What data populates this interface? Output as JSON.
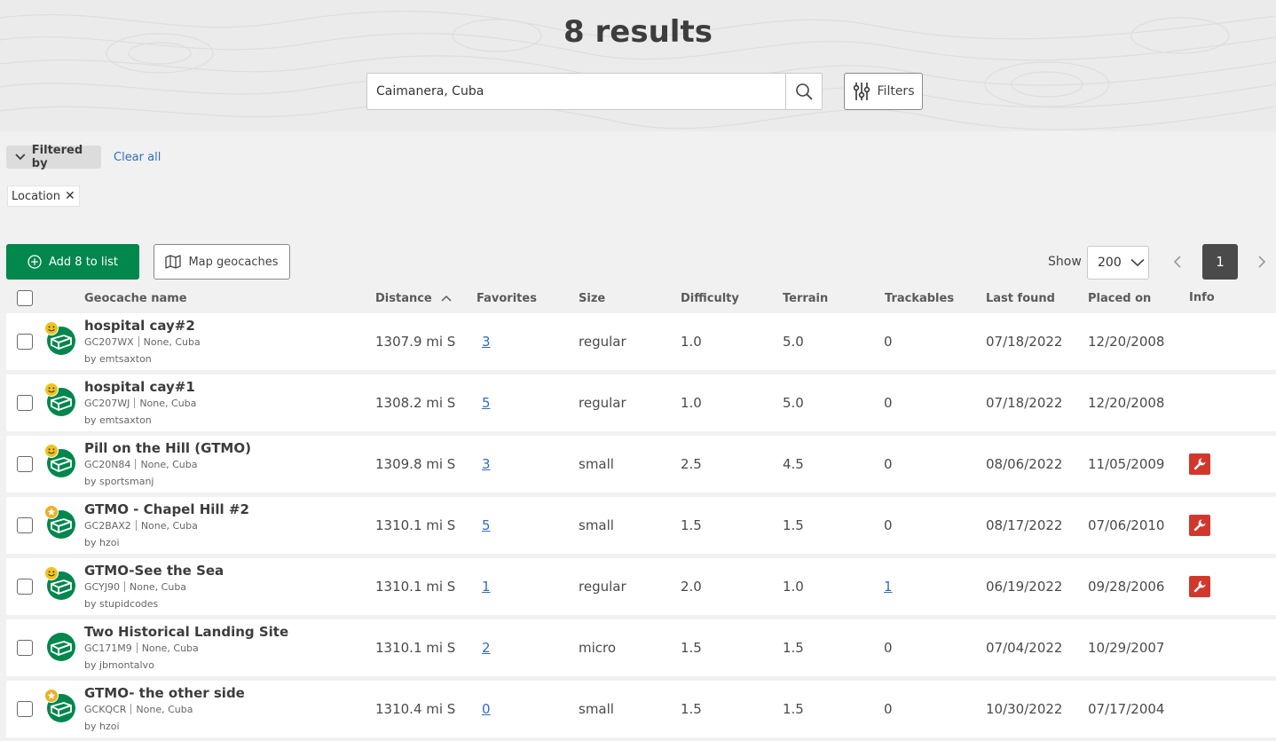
{
  "header": {
    "results_title": "8 results"
  },
  "search": {
    "value": "Caimanera, Cuba",
    "filters_label": "Filters"
  },
  "filter_bar": {
    "filtered_by_label": "Filtered by",
    "clear_all_label": "Clear all",
    "chips": [
      {
        "label": "Location"
      }
    ]
  },
  "actions": {
    "add_to_list_label": "Add 8 to list",
    "map_label": "Map geocaches"
  },
  "pagination": {
    "show_label": "Show",
    "page_size": "200",
    "current_page": "1"
  },
  "columns": {
    "name": "Geocache name",
    "distance": "Distance",
    "favorites": "Favorites",
    "size": "Size",
    "difficulty": "Difficulty",
    "terrain": "Terrain",
    "trackables": "Trackables",
    "last_found": "Last found",
    "placed_on": "Placed on",
    "info": "Info"
  },
  "rows": [
    {
      "badge": "smiley",
      "name": "hospital cay#2",
      "code": "GC207WX",
      "region": "None, Cuba",
      "owner": "by emtsaxton",
      "distance": "1307.9 mi S",
      "favorites": "3",
      "size": "regular",
      "difficulty": "1.0",
      "terrain": "5.0",
      "trackables": "0",
      "last_found": "07/18/2022",
      "placed_on": "12/20/2008",
      "info": false
    },
    {
      "badge": "smiley",
      "name": "hospital cay#1",
      "code": "GC207WJ",
      "region": "None, Cuba",
      "owner": "by emtsaxton",
      "distance": "1308.2 mi S",
      "favorites": "5",
      "size": "regular",
      "difficulty": "1.0",
      "terrain": "5.0",
      "trackables": "0",
      "last_found": "07/18/2022",
      "placed_on": "12/20/2008",
      "info": false
    },
    {
      "badge": "smiley",
      "name": "Pill on the Hill (GTMO)",
      "code": "GC20N84",
      "region": "None, Cuba",
      "owner": "by sportsmanj",
      "distance": "1309.8 mi S",
      "favorites": "3",
      "size": "small",
      "difficulty": "2.5",
      "terrain": "4.5",
      "trackables": "0",
      "last_found": "08/06/2022",
      "placed_on": "11/05/2009",
      "info": true
    },
    {
      "badge": "star",
      "name": "GTMO - Chapel Hill #2",
      "code": "GC2BAX2",
      "region": "None, Cuba",
      "owner": "by hzoi",
      "distance": "1310.1 mi S",
      "favorites": "5",
      "size": "small",
      "difficulty": "1.5",
      "terrain": "1.5",
      "trackables": "0",
      "last_found": "08/17/2022",
      "placed_on": "07/06/2010",
      "info": true
    },
    {
      "badge": "smiley",
      "name": "GTMO-See the Sea",
      "code": "GCYJ90",
      "region": "None, Cuba",
      "owner": "by stupidcodes",
      "distance": "1310.1 mi S",
      "favorites": "1",
      "size": "regular",
      "difficulty": "2.0",
      "terrain": "1.0",
      "trackables": "1",
      "last_found": "06/19/2022",
      "placed_on": "09/28/2006",
      "info": true
    },
    {
      "badge": "none",
      "name": "Two Historical Landing Site",
      "code": "GC171M9",
      "region": "None, Cuba",
      "owner": "by jbmontalvo",
      "distance": "1310.1 mi S",
      "favorites": "2",
      "size": "micro",
      "difficulty": "1.5",
      "terrain": "1.5",
      "trackables": "0",
      "last_found": "07/04/2022",
      "placed_on": "10/29/2007",
      "info": false
    },
    {
      "badge": "star",
      "name": "GTMO- the other side",
      "code": "GCKQCR",
      "region": "None, Cuba",
      "owner": "by hzoi",
      "distance": "1310.4 mi S",
      "favorites": "0",
      "size": "small",
      "difficulty": "1.5",
      "terrain": "1.5",
      "trackables": "0",
      "last_found": "10/30/2022",
      "placed_on": "07/17/2004",
      "info": false
    }
  ],
  "colors": {
    "brand_green": "#02874d",
    "link_blue": "#2f6ec5",
    "maintenance_red": "#d2372c",
    "badge_yellow": "#f2c21b"
  }
}
